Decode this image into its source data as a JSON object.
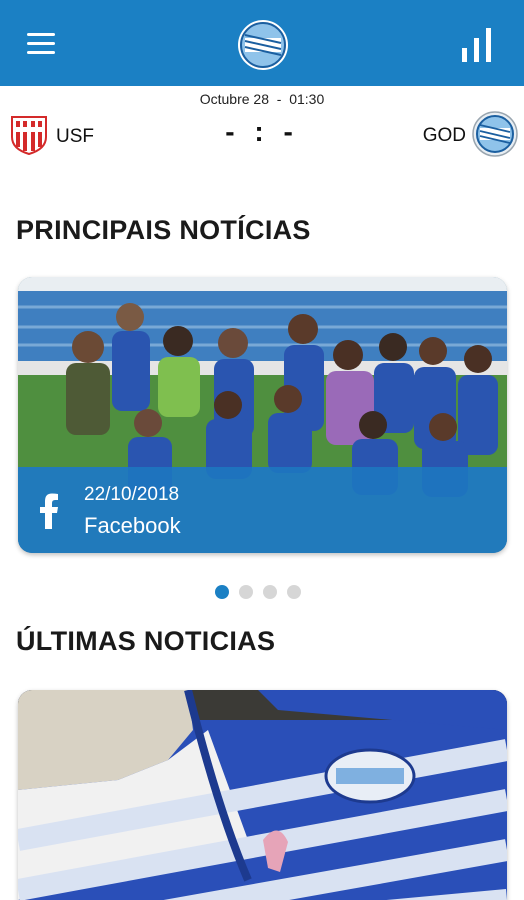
{
  "app_bar": {
    "menu_icon": "hamburger-menu-icon",
    "logo_icon": "godoy-cruz-crest-icon",
    "stats_icon": "bar-chart-icon",
    "color": "#1b80c4"
  },
  "match": {
    "date": "Octubre 28",
    "time": "01:30",
    "separator": "-",
    "home_team": {
      "name": "USF",
      "crest": "union-crest-icon"
    },
    "away_team": {
      "name": "GOD",
      "crest": "godoy-cruz-crest-icon"
    },
    "score": "- : -"
  },
  "principais": {
    "title": "PRINCIPAIS NOTÍCIAS",
    "slide": {
      "date": "22/10/2018",
      "source": "Facebook",
      "source_icon": "facebook-icon"
    },
    "carousel": {
      "total": 4,
      "active": 0
    }
  },
  "ultimas": {
    "title": "ÚLTIMAS NOTICIAS"
  }
}
